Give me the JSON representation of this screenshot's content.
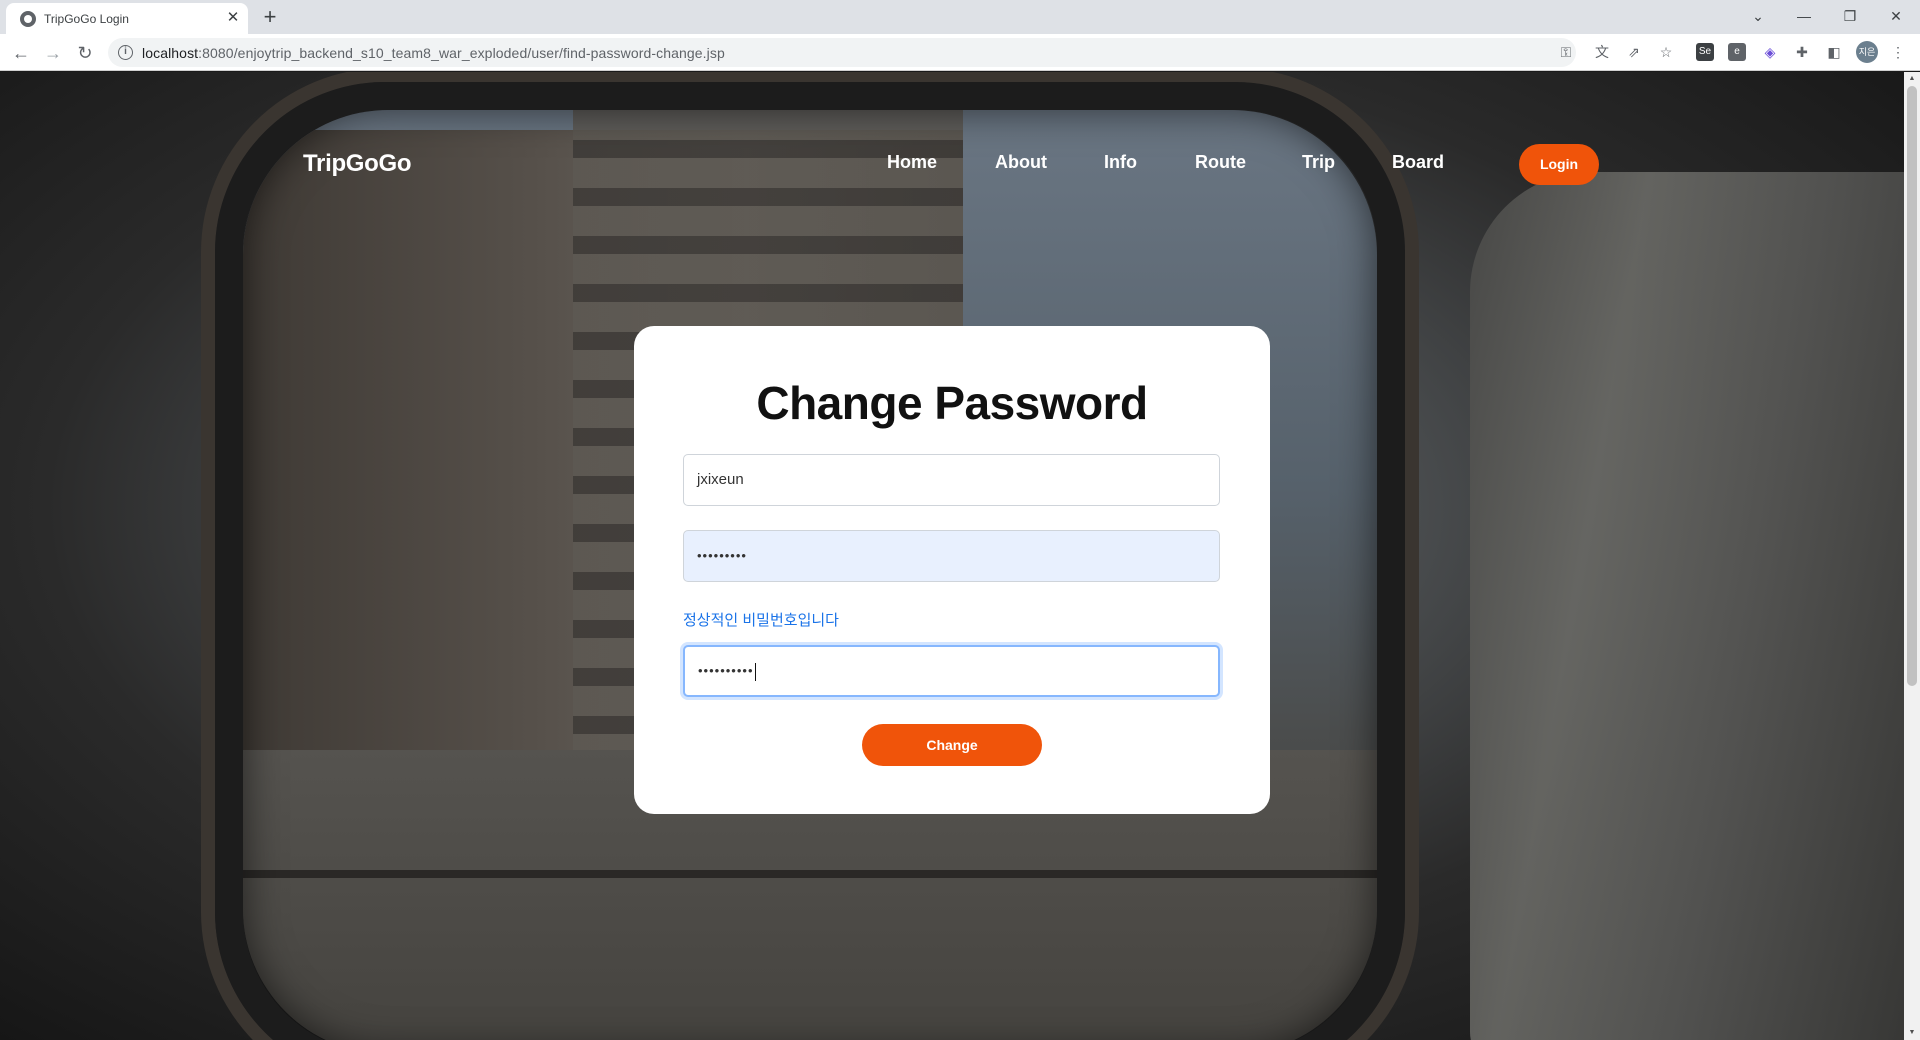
{
  "browser": {
    "tab_title": "TripGoGo Login",
    "tab_close": "✕",
    "new_tab": "+",
    "url_host": "localhost",
    "url_path": ":8080/enjoytrip_backend_s10_team8_war_exploded/user/find-password-change.jsp",
    "avatar_text": "지은",
    "ext_icons": [
      "Se",
      "e"
    ]
  },
  "header": {
    "brand": "TripGoGo",
    "nav": [
      "Home",
      "About",
      "Info",
      "Route",
      "Trip",
      "Board"
    ],
    "login_label": "Login"
  },
  "form": {
    "title": "Change Password",
    "user_id_value": "jxixeun",
    "password_value": "•••••••••",
    "password_hint": "정상적인 비밀번호입니다",
    "confirm_value": "••••••••••",
    "submit_label": "Change"
  },
  "colors": {
    "accent": "#f0540a",
    "hint": "#1a73e8",
    "autofill": "#e8f0fe"
  }
}
